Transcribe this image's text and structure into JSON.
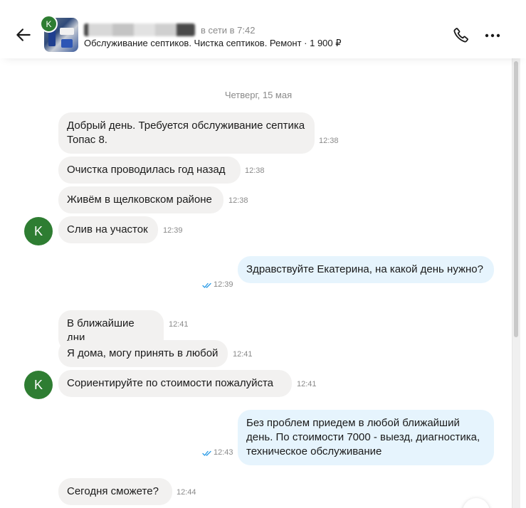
{
  "header": {
    "avatar_letter": "K",
    "status": "в сети в 7:42",
    "subtitle": "Обслуживание септиков. Чистка септиков. Ремонт · 1 900 ₽"
  },
  "date_separator": "Четверг, 15 мая",
  "sender_avatar_letter": "K",
  "messages": [
    {
      "text": "Добрый день. Требуется обслуживание септика Топас 8.",
      "time": "12:38"
    },
    {
      "text": "Очистка проводилась год назад",
      "time": "12:38"
    },
    {
      "text": "Живём в щелковском районе",
      "time": "12:38"
    },
    {
      "text": "Слив на участок",
      "time": "12:39"
    },
    {
      "text": "Здравствуйте Екатерина, на какой день нужно?",
      "time": "12:39"
    },
    {
      "text": "В ближайшие дни",
      "time": "12:41"
    },
    {
      "text": "Я дома, могу принять в любой",
      "time": "12:41"
    },
    {
      "text": "Сориентируйте по стоимости пожалуйста",
      "time": "12:41"
    },
    {
      "text": "Без проблем приедем в любой ближайший день. По стоимости 7000 - выезд, диагностика, техническое обслуживание",
      "time": "12:43"
    },
    {
      "text": "Сегодня сможете?",
      "time": "12:44"
    }
  ],
  "colors": {
    "avatar": "#2e7d32",
    "incoming": "#f2f1f0",
    "outgoing": "#e6f4fd",
    "read_checks": "#2b9be6"
  }
}
